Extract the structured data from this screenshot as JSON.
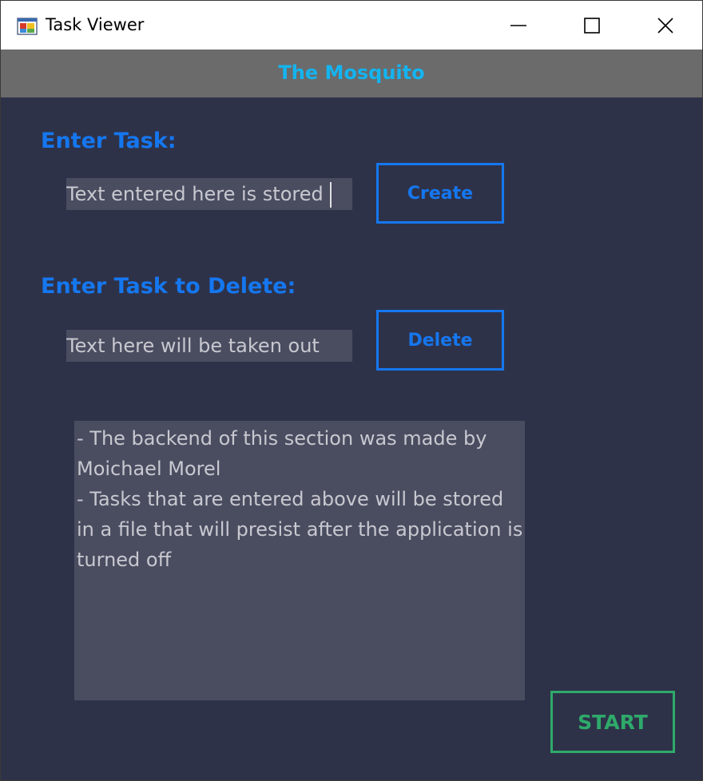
{
  "window": {
    "title": "Task Viewer",
    "icon": "app-window-icon",
    "controls": [
      "minimize-icon",
      "maximize-icon",
      "close-icon"
    ]
  },
  "header": {
    "title": "The Mosquito"
  },
  "create_section": {
    "label": "Enter Task:",
    "input_value": "Text entered here is stored",
    "button_label": "Create"
  },
  "delete_section": {
    "label": "Enter Task to Delete:",
    "input_value": "Text here will be taken out",
    "button_label": "Delete"
  },
  "info": {
    "lines": [
      "- The backend of this section was made by",
      "Moichael Morel",
      "- Tasks that are entered above will be stored",
      "in a file that will presist after the application is",
      "turned off"
    ]
  },
  "start_button": {
    "label": "START"
  },
  "colors": {
    "background": "#2e3249",
    "header_band": "#6b6b6b",
    "header_title": "#14b4f0",
    "accent_blue": "#1577f0",
    "start_green": "#2eaa6a",
    "input_bg": "#4a4d60"
  }
}
